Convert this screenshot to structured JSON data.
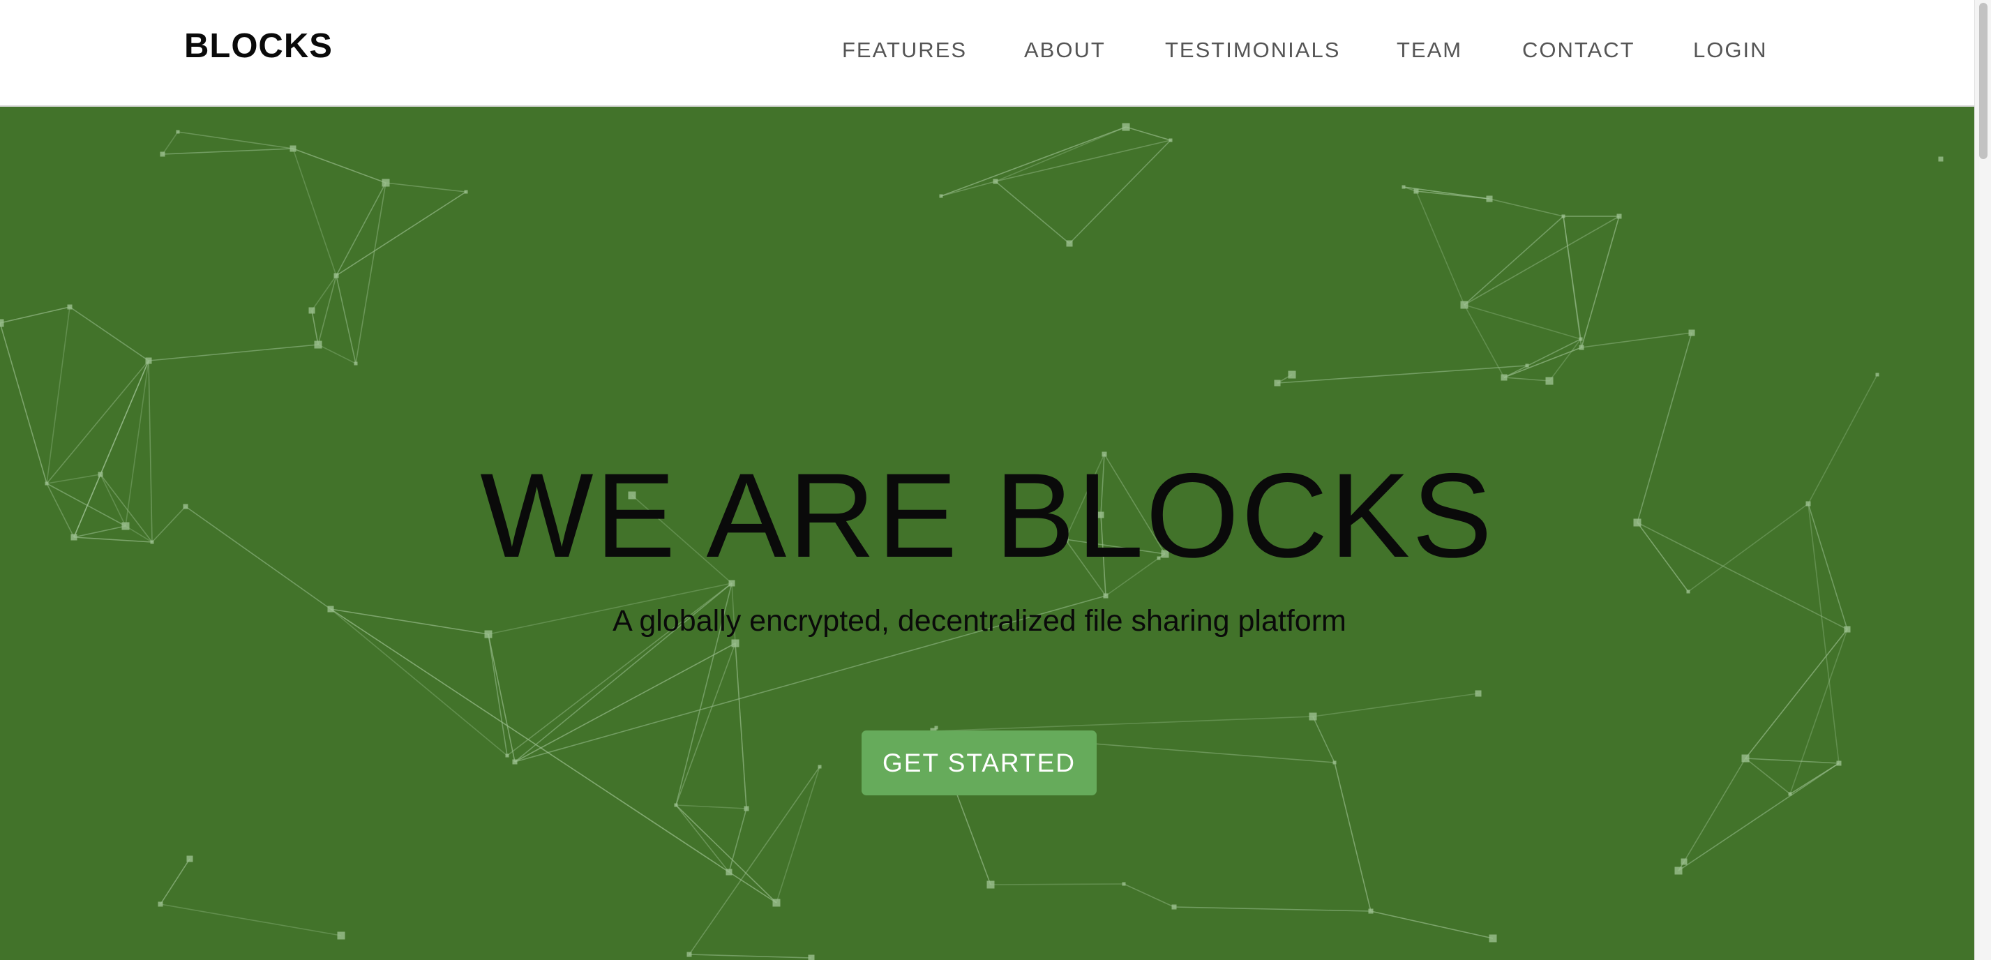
{
  "brand": "BLOCKS",
  "nav": {
    "items": [
      {
        "label": "FEATURES"
      },
      {
        "label": "ABOUT"
      },
      {
        "label": "TESTIMONIALS"
      },
      {
        "label": "TEAM"
      },
      {
        "label": "CONTACT"
      },
      {
        "label": "LOGIN"
      }
    ]
  },
  "hero": {
    "title": "WE ARE BLOCKS",
    "subtitle": "A globally encrypted, decentralized file sharing platform",
    "cta_label": "GET STARTED"
  },
  "colors": {
    "hero_background": "#42732a",
    "cta_background": "#66ab5b",
    "network_lines": "#9bbf8f",
    "nav_text": "#555555"
  }
}
